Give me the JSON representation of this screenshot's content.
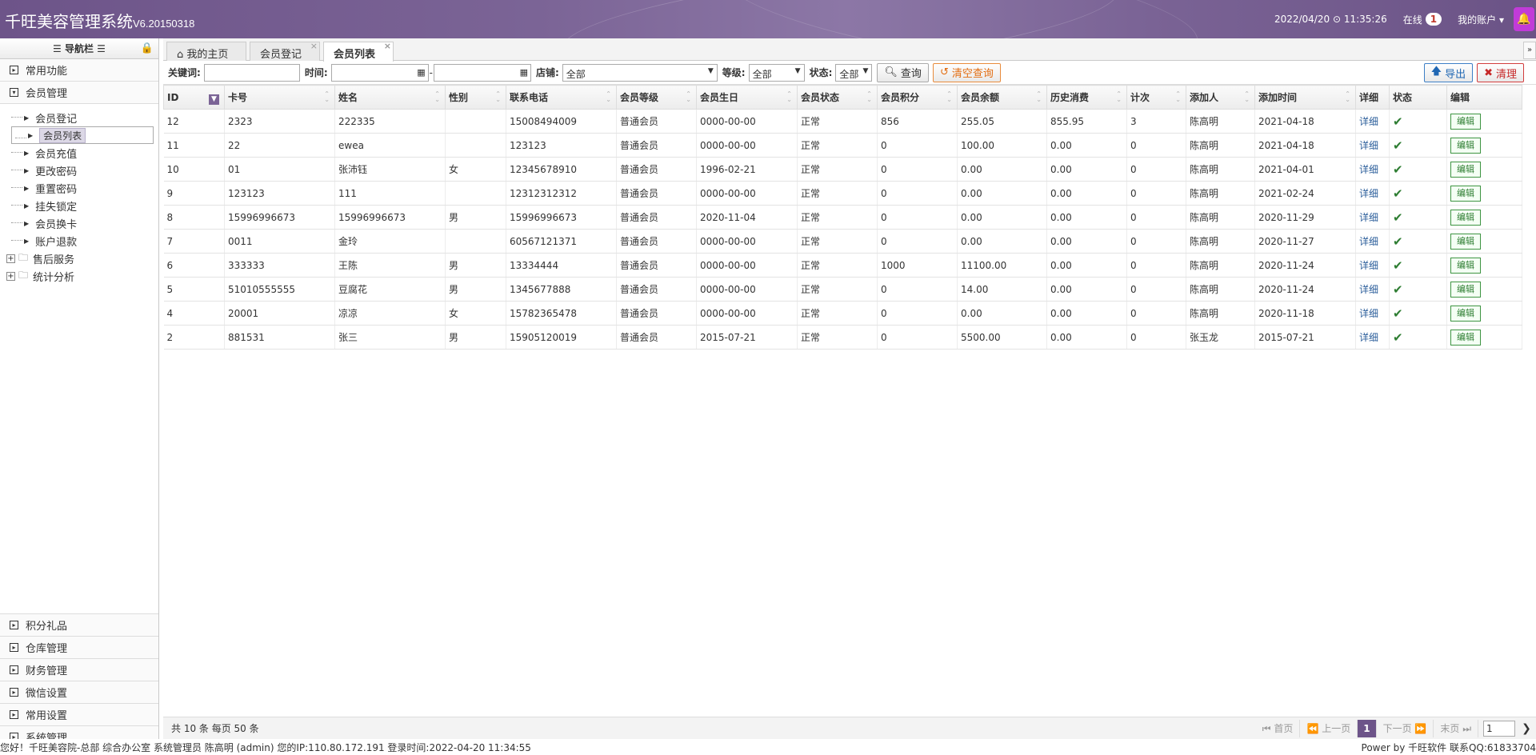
{
  "app": {
    "title": "千旺美容管理系统",
    "version": "V6.20150318"
  },
  "topbar": {
    "datetime": "2022/04/20",
    "time": "11:35:26",
    "online_label": "在线",
    "online_count": "1",
    "account_label": "我的账户"
  },
  "sidebar": {
    "header": "导航栏",
    "sections_top": [
      {
        "label": "常用功能"
      },
      {
        "label": "会员管理"
      }
    ],
    "tree": [
      {
        "label": "会员登记"
      },
      {
        "label": "会员列表"
      },
      {
        "label": "会员充值"
      },
      {
        "label": "更改密码"
      },
      {
        "label": "重置密码"
      },
      {
        "label": "挂失锁定"
      },
      {
        "label": "会员换卡"
      },
      {
        "label": "账户退款"
      }
    ],
    "folders": [
      {
        "label": "售后服务"
      },
      {
        "label": "统计分析"
      }
    ],
    "sections_bottom": [
      {
        "label": "积分礼品"
      },
      {
        "label": "仓库管理"
      },
      {
        "label": "财务管理"
      },
      {
        "label": "微信设置"
      },
      {
        "label": "常用设置"
      },
      {
        "label": "系统管理"
      }
    ]
  },
  "tabs": [
    {
      "label": "我的主页"
    },
    {
      "label": "会员登记"
    },
    {
      "label": "会员列表"
    }
  ],
  "toolbar": {
    "keyword_label": "关键词:",
    "time_label": "时间:",
    "store_label": "店铺:",
    "store_value": "全部",
    "level_label": "等级:",
    "level_value": "全部",
    "status_label": "状态:",
    "status_value": "全部",
    "query_btn": "查询",
    "clear_btn": "清空查询",
    "export_btn": "导出",
    "clean_btn": "清理"
  },
  "table": {
    "columns": [
      "ID",
      "卡号",
      "姓名",
      "性别",
      "联系电话",
      "会员等级",
      "会员生日",
      "会员状态",
      "会员积分",
      "会员余额",
      "历史消费",
      "计次",
      "添加人",
      "添加时间",
      "详细",
      "状态",
      "编辑"
    ],
    "detail_label": "详细",
    "edit_label": "编辑",
    "rows": [
      [
        "12",
        "2323",
        "222335",
        "",
        "15008494009",
        "普通会员",
        "0000-00-00",
        "正常",
        "856",
        "255.05",
        "855.95",
        "3",
        "陈高明",
        "2021-04-18"
      ],
      [
        "11",
        "22",
        "ewea",
        "",
        "123123",
        "普通会员",
        "0000-00-00",
        "正常",
        "0",
        "100.00",
        "0.00",
        "0",
        "陈高明",
        "2021-04-18"
      ],
      [
        "10",
        "01",
        "张沛钰",
        "女",
        "12345678910",
        "普通会员",
        "1996-02-21",
        "正常",
        "0",
        "0.00",
        "0.00",
        "0",
        "陈高明",
        "2021-04-01"
      ],
      [
        "9",
        "123123",
        "111",
        "",
        "12312312312",
        "普通会员",
        "0000-00-00",
        "正常",
        "0",
        "0.00",
        "0.00",
        "0",
        "陈高明",
        "2021-02-24"
      ],
      [
        "8",
        "15996996673",
        "15996996673",
        "男",
        "15996996673",
        "普通会员",
        "2020-11-04",
        "正常",
        "0",
        "0.00",
        "0.00",
        "0",
        "陈高明",
        "2020-11-29"
      ],
      [
        "7",
        "0011",
        "金玲",
        "",
        "60567121371",
        "普通会员",
        "0000-00-00",
        "正常",
        "0",
        "0.00",
        "0.00",
        "0",
        "陈高明",
        "2020-11-27"
      ],
      [
        "6",
        "333333",
        "王陈",
        "男",
        "13334444",
        "普通会员",
        "0000-00-00",
        "正常",
        "1000",
        "11100.00",
        "0.00",
        "0",
        "陈高明",
        "2020-11-24"
      ],
      [
        "5",
        "51010555555",
        "豆腐花",
        "男",
        "1345677888",
        "普通会员",
        "0000-00-00",
        "正常",
        "0",
        "14.00",
        "0.00",
        "0",
        "陈高明",
        "2020-11-24"
      ],
      [
        "4",
        "20001",
        "凉凉",
        "女",
        "15782365478",
        "普通会员",
        "0000-00-00",
        "正常",
        "0",
        "0.00",
        "0.00",
        "0",
        "陈高明",
        "2020-11-18"
      ],
      [
        "2",
        "881531",
        "张三",
        "男",
        "15905120019",
        "普通会员",
        "2015-07-21",
        "正常",
        "0",
        "5500.00",
        "0.00",
        "0",
        "张玉龙",
        "2015-07-21"
      ]
    ]
  },
  "footer": {
    "summary": "共 10 条 每页 50 条",
    "first": "首页",
    "prev": "上一页",
    "current": "1",
    "next": "下一页",
    "last": "末页",
    "page_input": "1"
  },
  "statusbar": {
    "left": "您好！千旺美容院-总部 综合办公室 系统管理员 陈高明 (admin) 您的IP:110.80.172.191 登录时间:2022-04-20 11:34:55",
    "right": "Power by 千旺软件 联系QQ:61833704"
  }
}
